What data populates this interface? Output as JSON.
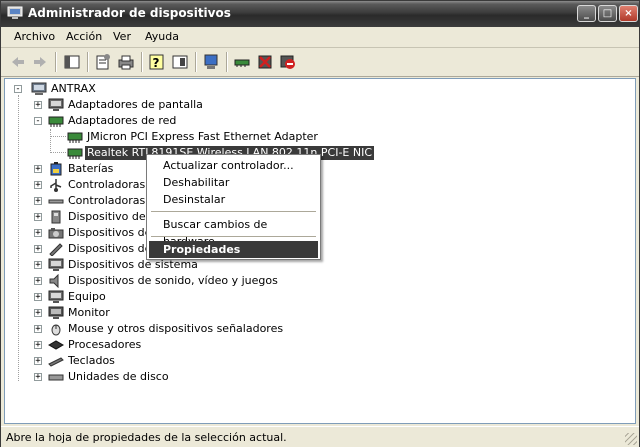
{
  "window": {
    "title": "Administrador de dispositivos"
  },
  "menu": {
    "items": [
      "Archivo",
      "Acción",
      "Ver",
      "Ayuda"
    ]
  },
  "toolbar": {
    "buttons": [
      "back-icon",
      "forward-icon",
      "console-tree-icon",
      "properties-icon",
      "print-icon",
      "help-icon",
      "view-icon",
      "scan-hardware-icon",
      "update-driver-icon",
      "uninstall-icon",
      "disable-icon"
    ]
  },
  "tree": {
    "root": "ANTRAX",
    "items": [
      "Adaptadores de pantalla",
      "Adaptadores de red",
      "JMicron PCI Express Fast Ethernet Adapter",
      "Realtek RTL8191SE Wireless LAN 802.11n PCI-E NIC",
      "Baterías",
      "Controladoras d",
      "Controladoras I",
      "Dispositivo de m",
      "Dispositivos de",
      "Dispositivos de",
      "Dispositivos de sistema",
      "Dispositivos de sonido, vídeo y juegos",
      "Equipo",
      "Monitor",
      "Mouse y otros dispositivos señaladores",
      "Procesadores",
      "Teclados",
      "Unidades de disco"
    ]
  },
  "context_menu": {
    "items": [
      "Actualizar controlador...",
      "Deshabilitar",
      "Desinstalar",
      "Buscar cambios de hardware",
      "Propiedades"
    ],
    "highlighted": "Propiedades"
  },
  "status": {
    "text": "Abre la hoja de propiedades de la selección actual."
  }
}
